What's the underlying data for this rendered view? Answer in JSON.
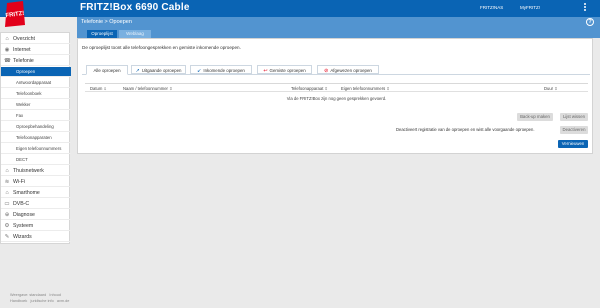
{
  "app": {
    "logo_text": "FRITZ!",
    "title": "FRITZ!Box 6690 Cable",
    "nav_links": [
      "FRITZ!NAS",
      "MyFRITZ!"
    ]
  },
  "breadcrumb": "Telefonie > Opoepen",
  "page_tabs": [
    "Oproeplijst",
    "Weblaag"
  ],
  "intro": "De oproeplijst toont alle telefoongesprekken en gemiste inkomende oproepen.",
  "filter_tabs": [
    {
      "label": "Alle oproepen",
      "icon": ""
    },
    {
      "label": "Uitgaande oproepen",
      "icon": "↗"
    },
    {
      "label": "Inkomende oproepen",
      "icon": "↙"
    },
    {
      "label": "Gemiste oproepen",
      "icon": "↩"
    },
    {
      "label": "Afgewezen oproepen",
      "icon": "⊘"
    }
  ],
  "table": {
    "columns": [
      "Datum",
      "Naam / telefoonnummer",
      "Telefoonapparaat",
      "Eigen telefoonnummers",
      "Duur"
    ],
    "empty_message": "Via de FRITZ!Box zijn nog geen gesprekken gevoerd."
  },
  "buttons": {
    "backup": "Back-up maken",
    "clear": "Lijst wissen",
    "deactivate": "Deactiveren",
    "refresh": "Vernieuwen"
  },
  "deactivate_text": "Deactiveert registratie van de oproepen en wist alle voorgaande oproepen.",
  "sidebar": [
    {
      "label": "Overzicht",
      "icon": "⌂",
      "level": 0
    },
    {
      "label": "Internet",
      "icon": "◉",
      "level": 0
    },
    {
      "label": "Telefonie",
      "icon": "☎",
      "level": 0
    },
    {
      "label": "Oproepen",
      "icon": "",
      "level": 1,
      "selected": true
    },
    {
      "label": "Antwoordapparaat",
      "icon": "",
      "level": 1
    },
    {
      "label": "Telefoonboek",
      "icon": "",
      "level": 1
    },
    {
      "label": "Wekker",
      "icon": "",
      "level": 1
    },
    {
      "label": "Fax",
      "icon": "",
      "level": 1
    },
    {
      "label": "Oproepbehandeling",
      "icon": "",
      "level": 1
    },
    {
      "label": "Telefoonapparaten",
      "icon": "",
      "level": 1
    },
    {
      "label": "Eigen telefoonnummers",
      "icon": "",
      "level": 1
    },
    {
      "label": "DECT",
      "icon": "",
      "level": 1
    },
    {
      "label": "Thuisnetwerk",
      "icon": "⌂",
      "level": 0
    },
    {
      "label": "Wi-Fi",
      "icon": "≋",
      "level": 0
    },
    {
      "label": "Smarthome",
      "icon": "⌂",
      "level": 0
    },
    {
      "label": "DVB-C",
      "icon": "▭",
      "level": 0
    },
    {
      "label": "Diagnose",
      "icon": "⊕",
      "level": 0
    },
    {
      "label": "Systeem",
      "icon": "⚙",
      "level": 0
    },
    {
      "label": "Wizards",
      "icon": "✎",
      "level": 0
    }
  ],
  "footer": {
    "line1": [
      "Weergave: standaard",
      "Inhoud"
    ],
    "line2": [
      "Handboek",
      "juridische info",
      "avm.de"
    ]
  },
  "colors": {
    "brand": "#0a64b4",
    "subbar": "#5294d0",
    "logo_red": "#e2001a"
  }
}
